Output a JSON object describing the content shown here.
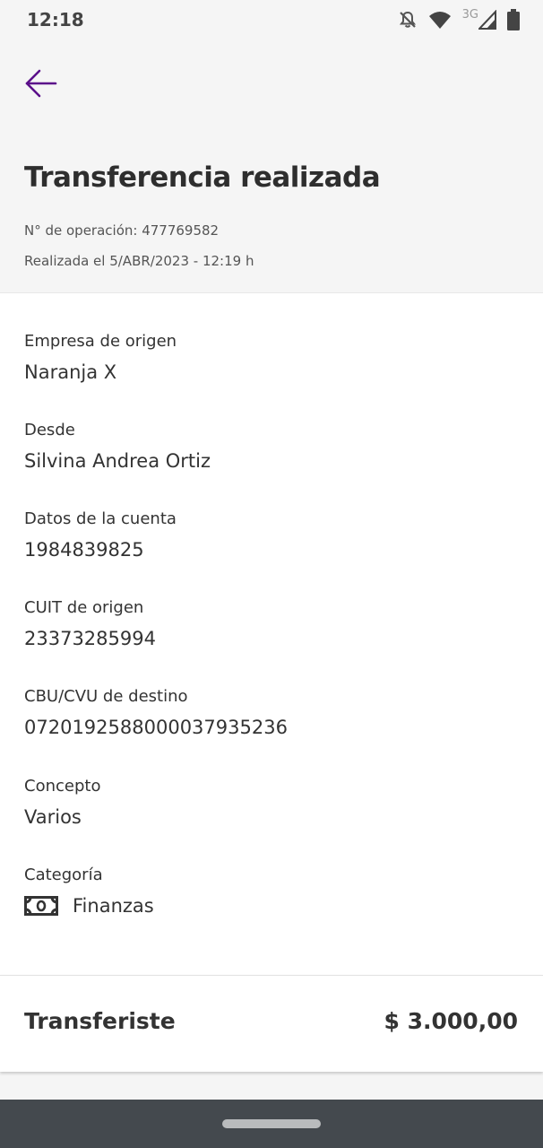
{
  "status_bar": {
    "time": "12:18",
    "network": "3G",
    "icons": [
      "notifications-off-icon",
      "wifi-icon",
      "signal-icon",
      "battery-icon"
    ]
  },
  "header": {
    "back_icon": "arrow-left-icon",
    "title": "Transferencia realizada",
    "operation_number": "N° de operación: 477769582",
    "date": "Realizada el 5/ABR/2023 - 12:19 h"
  },
  "details": {
    "fields": [
      {
        "label": "Empresa de origen",
        "value": "Naranja X"
      },
      {
        "label": "Desde",
        "value": "Silvina Andrea Ortiz"
      },
      {
        "label": "Datos de la cuenta",
        "value": "1984839825"
      },
      {
        "label": "CUIT de origen",
        "value": "23373285994"
      },
      {
        "label": "CBU/CVU de destino",
        "value": "0720192588000037935236"
      },
      {
        "label": "Concepto",
        "value": "Varios"
      }
    ],
    "category": {
      "label": "Categoría",
      "value": "Finanzas",
      "icon": "banknote-icon"
    }
  },
  "summary": {
    "label": "Transferiste",
    "amount": "$ 3.000,00"
  },
  "colors": {
    "accent": "#5b0f8a",
    "background": "#f5f5f5",
    "nav_bar": "#44494e"
  }
}
